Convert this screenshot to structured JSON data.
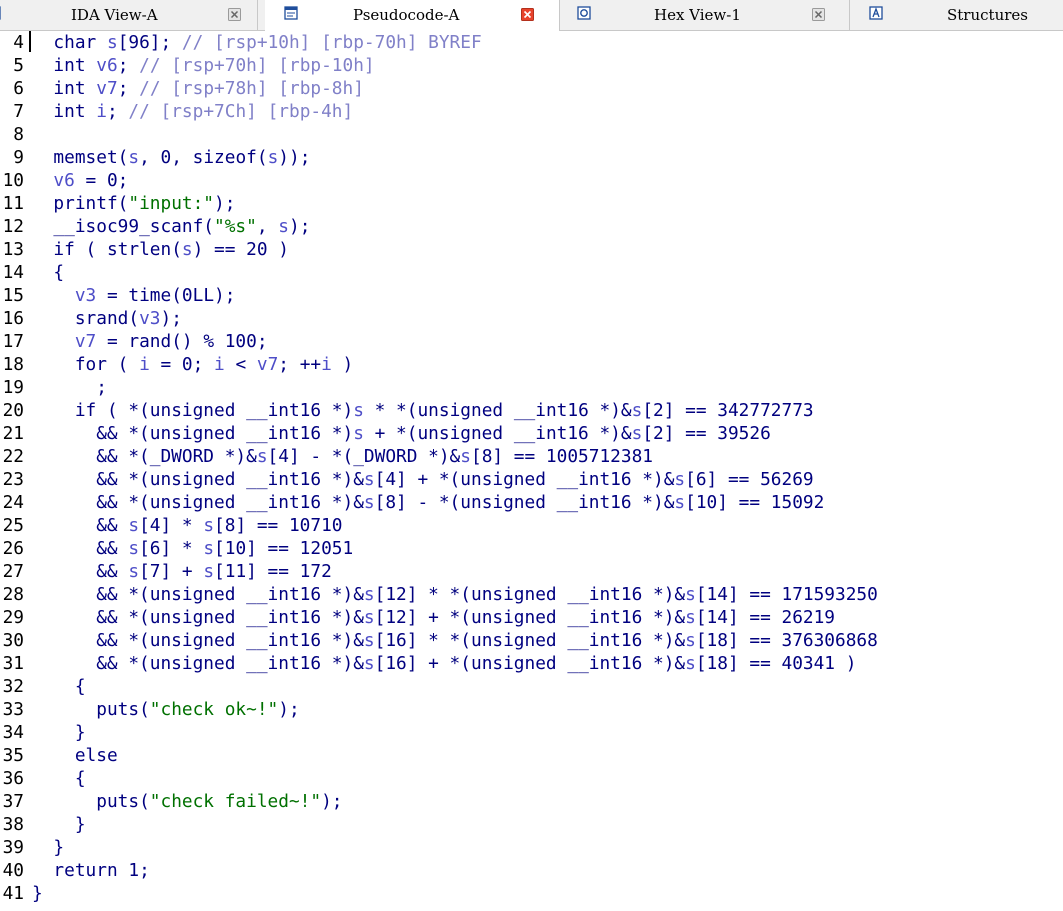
{
  "tabs": [
    {
      "label": "IDA View-A",
      "icon": "ida-view-icon",
      "closable": true,
      "active": false
    },
    {
      "label": "Pseudocode-A",
      "icon": "pseudocode-icon",
      "closable": true,
      "active": true
    },
    {
      "label": "Hex View-1",
      "icon": "hex-view-icon",
      "closable": true,
      "active": false
    },
    {
      "label": "Structures",
      "icon": "structures-icon",
      "closable": false,
      "active": false
    }
  ],
  "colors": {
    "code": "#00007f",
    "variable": "#4e4ec8",
    "string": "#007000",
    "comment": "#8080c8",
    "line_number": "#000000",
    "close_button": "#e8432c"
  },
  "code_lines": [
    {
      "n": "4",
      "code": "  char s[96]; // [rsp+10h] [rbp-70h] BYREF"
    },
    {
      "n": "5",
      "code": "  int v6; // [rsp+70h] [rbp-10h]"
    },
    {
      "n": "6",
      "code": "  int v7; // [rsp+78h] [rbp-8h]"
    },
    {
      "n": "7",
      "code": "  int i; // [rsp+7Ch] [rbp-4h]"
    },
    {
      "n": "8",
      "code": ""
    },
    {
      "n": "9",
      "code": "  memset(s, 0, sizeof(s));"
    },
    {
      "n": "10",
      "code": "  v6 = 0;"
    },
    {
      "n": "11",
      "code": "  printf(\"input:\");"
    },
    {
      "n": "12",
      "code": "  __isoc99_scanf(\"%s\", s);"
    },
    {
      "n": "13",
      "code": "  if ( strlen(s) == 20 )"
    },
    {
      "n": "14",
      "code": "  {"
    },
    {
      "n": "15",
      "code": "    v3 = time(0LL);"
    },
    {
      "n": "16",
      "code": "    srand(v3);"
    },
    {
      "n": "17",
      "code": "    v7 = rand() % 100;"
    },
    {
      "n": "18",
      "code": "    for ( i = 0; i < v7; ++i )"
    },
    {
      "n": "19",
      "code": "      ;"
    },
    {
      "n": "20",
      "code": "    if ( *(unsigned __int16 *)s * *(unsigned __int16 *)&s[2] == 342772773"
    },
    {
      "n": "21",
      "code": "      && *(unsigned __int16 *)s + *(unsigned __int16 *)&s[2] == 39526"
    },
    {
      "n": "22",
      "code": "      && *(_DWORD *)&s[4] - *(_DWORD *)&s[8] == 1005712381"
    },
    {
      "n": "23",
      "code": "      && *(unsigned __int16 *)&s[4] + *(unsigned __int16 *)&s[6] == 56269"
    },
    {
      "n": "24",
      "code": "      && *(unsigned __int16 *)&s[8] - *(unsigned __int16 *)&s[10] == 15092"
    },
    {
      "n": "25",
      "code": "      && s[4] * s[8] == 10710"
    },
    {
      "n": "26",
      "code": "      && s[6] * s[10] == 12051"
    },
    {
      "n": "27",
      "code": "      && s[7] + s[11] == 172"
    },
    {
      "n": "28",
      "code": "      && *(unsigned __int16 *)&s[12] * *(unsigned __int16 *)&s[14] == 171593250"
    },
    {
      "n": "29",
      "code": "      && *(unsigned __int16 *)&s[12] + *(unsigned __int16 *)&s[14] == 26219"
    },
    {
      "n": "30",
      "code": "      && *(unsigned __int16 *)&s[16] * *(unsigned __int16 *)&s[18] == 376306868"
    },
    {
      "n": "31",
      "code": "      && *(unsigned __int16 *)&s[16] + *(unsigned __int16 *)&s[18] == 40341 )"
    },
    {
      "n": "32",
      "code": "    {"
    },
    {
      "n": "33",
      "code": "      puts(\"check ok~!\");"
    },
    {
      "n": "34",
      "code": "    }"
    },
    {
      "n": "35",
      "code": "    else"
    },
    {
      "n": "36",
      "code": "    {"
    },
    {
      "n": "37",
      "code": "      puts(\"check failed~!\");"
    },
    {
      "n": "38",
      "code": "    }"
    },
    {
      "n": "39",
      "code": "  }"
    },
    {
      "n": "40",
      "code": "  return 1;"
    },
    {
      "n": "41",
      "code": "}"
    }
  ]
}
